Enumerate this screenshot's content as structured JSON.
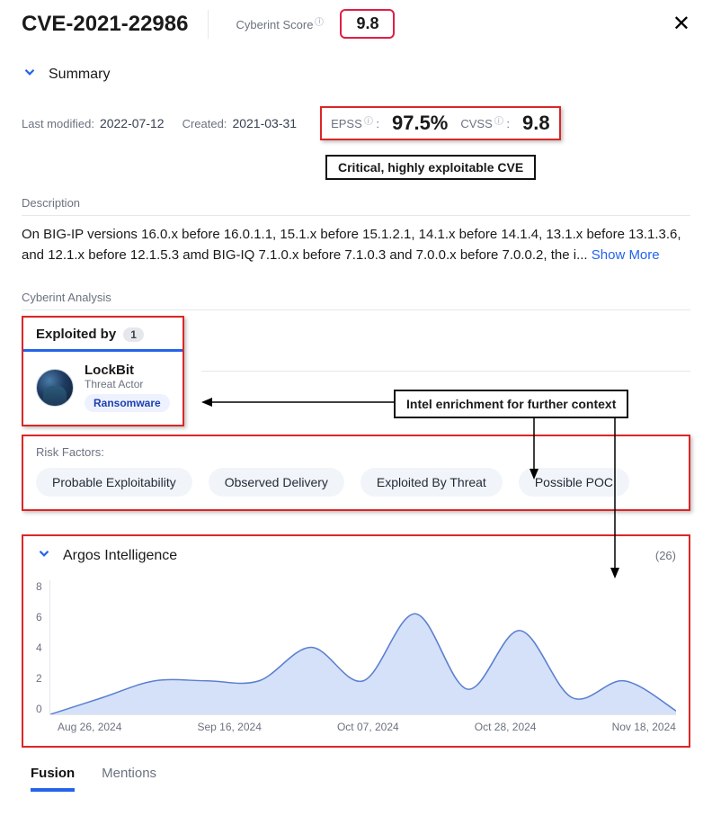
{
  "header": {
    "cve": "CVE-2021-22986",
    "score_label": "Cyberint Score",
    "score_value": "9.8"
  },
  "summary": {
    "title": "Summary",
    "last_modified_label": "Last modified:",
    "last_modified": "2022-07-12",
    "created_label": "Created:",
    "created": "2021-03-31",
    "epss_label": "EPSS",
    "epss": "97.5%",
    "cvss_label": "CVSS",
    "cvss": "9.8",
    "annot": "Critical, highly exploitable CVE"
  },
  "description": {
    "label": "Description",
    "text": "On BIG-IP versions 16.0.x before 16.0.1.1, 15.1.x before 15.1.2.1, 14.1.x before 14.1.4, 13.1.x before 13.1.3.6, and 12.1.x before 12.1.5.3 amd BIG-IQ 7.1.0.x before 7.1.0.3 and 7.0.0.x before 7.0.0.2, the i... ",
    "more": "Show More"
  },
  "analysis": {
    "label": "Cyberint Analysis",
    "tab_label": "Exploited by",
    "tab_count": "1",
    "actor": {
      "name": "LockBit",
      "type": "Threat Actor",
      "tag": "Ransomware"
    },
    "annot": "Intel enrichment for further context"
  },
  "risk": {
    "label": "Risk Factors:",
    "pills": [
      "Probable Exploitability",
      "Observed Delivery",
      "Exploited By Threat",
      "Possible POC"
    ]
  },
  "argos": {
    "title": "Argos Intelligence",
    "count": "(26)",
    "y_ticks": [
      "8",
      "6",
      "4",
      "2",
      "0"
    ],
    "x_ticks": [
      "Aug 26, 2024",
      "Sep 16, 2024",
      "Oct 07, 2024",
      "Oct 28, 2024",
      "Nov 18, 2024"
    ]
  },
  "tabs": {
    "fusion": "Fusion",
    "mentions": "Mentions"
  },
  "chart_data": {
    "type": "area",
    "title": "Argos Intelligence",
    "ylabel": "",
    "xlabel": "",
    "ylim": [
      0,
      8
    ],
    "x": [
      "Aug 26, 2024",
      "Sep 02, 2024",
      "Sep 09, 2024",
      "Sep 16, 2024",
      "Sep 23, 2024",
      "Sep 30, 2024",
      "Oct 07, 2024",
      "Oct 14, 2024",
      "Oct 21, 2024",
      "Oct 28, 2024",
      "Nov 04, 2024",
      "Nov 11, 2024",
      "Nov 18, 2024"
    ],
    "values": [
      0,
      1,
      2,
      2,
      2,
      4,
      2,
      6,
      1.5,
      5,
      1,
      2,
      0.2
    ]
  }
}
